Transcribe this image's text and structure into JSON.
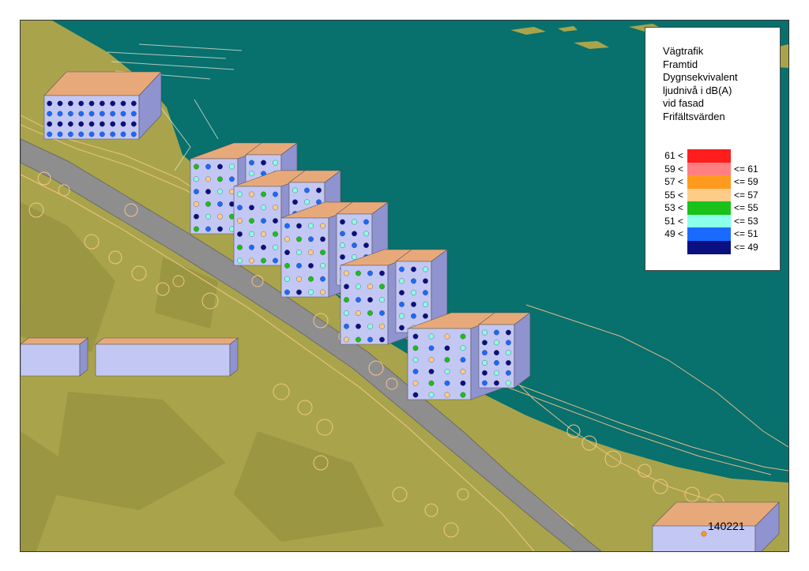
{
  "legend": {
    "title_lines": [
      "Vägtrafik",
      "Framtid",
      "Dygnsekvivalent",
      "ljudnivå i dB(A)",
      "vid fasad",
      "Frifältsvärden"
    ],
    "classes": [
      {
        "low": "61 <",
        "high": "",
        "color": "#ff1e1e"
      },
      {
        "low": "59 <",
        "high": "<= 61",
        "color": "#ff8080"
      },
      {
        "low": "57 <",
        "high": "<= 59",
        "color": "#ff9a1e"
      },
      {
        "low": "55 <",
        "high": "<= 57",
        "color": "#ffcc88"
      },
      {
        "low": "53 <",
        "high": "<= 55",
        "color": "#19c119"
      },
      {
        "low": "51 <",
        "high": "<= 53",
        "color": "#8affea"
      },
      {
        "low": "49 <",
        "high": "<= 51",
        "color": "#1a6aff"
      },
      {
        "low": "",
        "high": "<= 49",
        "color": "#0a1080"
      }
    ]
  },
  "date_label": "140221",
  "colors": {
    "water": "#08706d",
    "terrain": "#a9a44b",
    "road": "#8e8e8e",
    "roof": "#e8a97a",
    "wall": "#c3c7f3",
    "wall_shade": "#8f93cf",
    "tree_outline": "#f4c48a"
  }
}
